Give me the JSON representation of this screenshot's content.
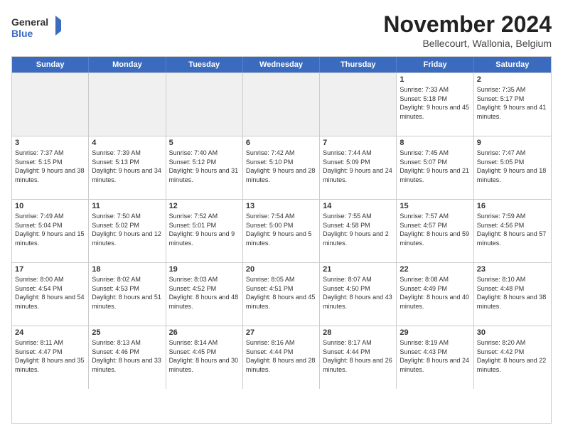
{
  "logo": {
    "line1": "General",
    "line2": "Blue"
  },
  "title": "November 2024",
  "location": "Bellecourt, Wallonia, Belgium",
  "days_of_week": [
    "Sunday",
    "Monday",
    "Tuesday",
    "Wednesday",
    "Thursday",
    "Friday",
    "Saturday"
  ],
  "weeks": [
    [
      {
        "day": "",
        "info": ""
      },
      {
        "day": "",
        "info": ""
      },
      {
        "day": "",
        "info": ""
      },
      {
        "day": "",
        "info": ""
      },
      {
        "day": "",
        "info": ""
      },
      {
        "day": "1",
        "info": "Sunrise: 7:33 AM\nSunset: 5:18 PM\nDaylight: 9 hours and 45 minutes."
      },
      {
        "day": "2",
        "info": "Sunrise: 7:35 AM\nSunset: 5:17 PM\nDaylight: 9 hours and 41 minutes."
      }
    ],
    [
      {
        "day": "3",
        "info": "Sunrise: 7:37 AM\nSunset: 5:15 PM\nDaylight: 9 hours and 38 minutes."
      },
      {
        "day": "4",
        "info": "Sunrise: 7:39 AM\nSunset: 5:13 PM\nDaylight: 9 hours and 34 minutes."
      },
      {
        "day": "5",
        "info": "Sunrise: 7:40 AM\nSunset: 5:12 PM\nDaylight: 9 hours and 31 minutes."
      },
      {
        "day": "6",
        "info": "Sunrise: 7:42 AM\nSunset: 5:10 PM\nDaylight: 9 hours and 28 minutes."
      },
      {
        "day": "7",
        "info": "Sunrise: 7:44 AM\nSunset: 5:09 PM\nDaylight: 9 hours and 24 minutes."
      },
      {
        "day": "8",
        "info": "Sunrise: 7:45 AM\nSunset: 5:07 PM\nDaylight: 9 hours and 21 minutes."
      },
      {
        "day": "9",
        "info": "Sunrise: 7:47 AM\nSunset: 5:05 PM\nDaylight: 9 hours and 18 minutes."
      }
    ],
    [
      {
        "day": "10",
        "info": "Sunrise: 7:49 AM\nSunset: 5:04 PM\nDaylight: 9 hours and 15 minutes."
      },
      {
        "day": "11",
        "info": "Sunrise: 7:50 AM\nSunset: 5:02 PM\nDaylight: 9 hours and 12 minutes."
      },
      {
        "day": "12",
        "info": "Sunrise: 7:52 AM\nSunset: 5:01 PM\nDaylight: 9 hours and 9 minutes."
      },
      {
        "day": "13",
        "info": "Sunrise: 7:54 AM\nSunset: 5:00 PM\nDaylight: 9 hours and 5 minutes."
      },
      {
        "day": "14",
        "info": "Sunrise: 7:55 AM\nSunset: 4:58 PM\nDaylight: 9 hours and 2 minutes."
      },
      {
        "day": "15",
        "info": "Sunrise: 7:57 AM\nSunset: 4:57 PM\nDaylight: 8 hours and 59 minutes."
      },
      {
        "day": "16",
        "info": "Sunrise: 7:59 AM\nSunset: 4:56 PM\nDaylight: 8 hours and 57 minutes."
      }
    ],
    [
      {
        "day": "17",
        "info": "Sunrise: 8:00 AM\nSunset: 4:54 PM\nDaylight: 8 hours and 54 minutes."
      },
      {
        "day": "18",
        "info": "Sunrise: 8:02 AM\nSunset: 4:53 PM\nDaylight: 8 hours and 51 minutes."
      },
      {
        "day": "19",
        "info": "Sunrise: 8:03 AM\nSunset: 4:52 PM\nDaylight: 8 hours and 48 minutes."
      },
      {
        "day": "20",
        "info": "Sunrise: 8:05 AM\nSunset: 4:51 PM\nDaylight: 8 hours and 45 minutes."
      },
      {
        "day": "21",
        "info": "Sunrise: 8:07 AM\nSunset: 4:50 PM\nDaylight: 8 hours and 43 minutes."
      },
      {
        "day": "22",
        "info": "Sunrise: 8:08 AM\nSunset: 4:49 PM\nDaylight: 8 hours and 40 minutes."
      },
      {
        "day": "23",
        "info": "Sunrise: 8:10 AM\nSunset: 4:48 PM\nDaylight: 8 hours and 38 minutes."
      }
    ],
    [
      {
        "day": "24",
        "info": "Sunrise: 8:11 AM\nSunset: 4:47 PM\nDaylight: 8 hours and 35 minutes."
      },
      {
        "day": "25",
        "info": "Sunrise: 8:13 AM\nSunset: 4:46 PM\nDaylight: 8 hours and 33 minutes."
      },
      {
        "day": "26",
        "info": "Sunrise: 8:14 AM\nSunset: 4:45 PM\nDaylight: 8 hours and 30 minutes."
      },
      {
        "day": "27",
        "info": "Sunrise: 8:16 AM\nSunset: 4:44 PM\nDaylight: 8 hours and 28 minutes."
      },
      {
        "day": "28",
        "info": "Sunrise: 8:17 AM\nSunset: 4:44 PM\nDaylight: 8 hours and 26 minutes."
      },
      {
        "day": "29",
        "info": "Sunrise: 8:19 AM\nSunset: 4:43 PM\nDaylight: 8 hours and 24 minutes."
      },
      {
        "day": "30",
        "info": "Sunrise: 8:20 AM\nSunset: 4:42 PM\nDaylight: 8 hours and 22 minutes."
      }
    ]
  ]
}
